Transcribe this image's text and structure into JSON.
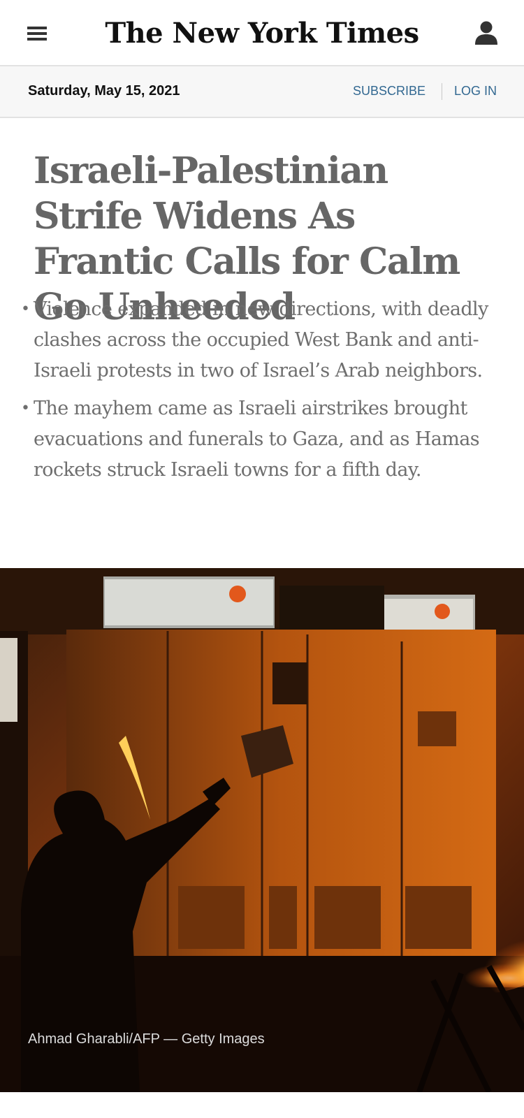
{
  "header": {
    "logo": "The New York Times",
    "menu_icon": "hamburger-menu-icon",
    "account_icon": "person-icon"
  },
  "datebar": {
    "date": "Saturday, May 15, 2021",
    "subscribe": "SUBSCRIBE",
    "login": "LOG IN"
  },
  "article": {
    "headline": "Israeli-Palestinian Strife Widens As Frantic Calls for Calm Go Unheeded",
    "summary": [
      "Violence expanded in new directions, with deadly clashes across the occupied West Bank and anti-Israeli protests in two of Israel’s Arab neighbors.",
      "The mayhem came as Israeli airstrikes brought evacuations and funerals to Gaza, and as Hamas rockets struck Israeli towns for a fifth day."
    ],
    "bullet": "•",
    "photo_credit": "Ahmad Gharabli/AFP — Getty Images"
  },
  "colors": {
    "link": "#326891",
    "headline": "#666666",
    "summary": "#6e6e6e",
    "datebar_bg": "#f7f7f7"
  }
}
